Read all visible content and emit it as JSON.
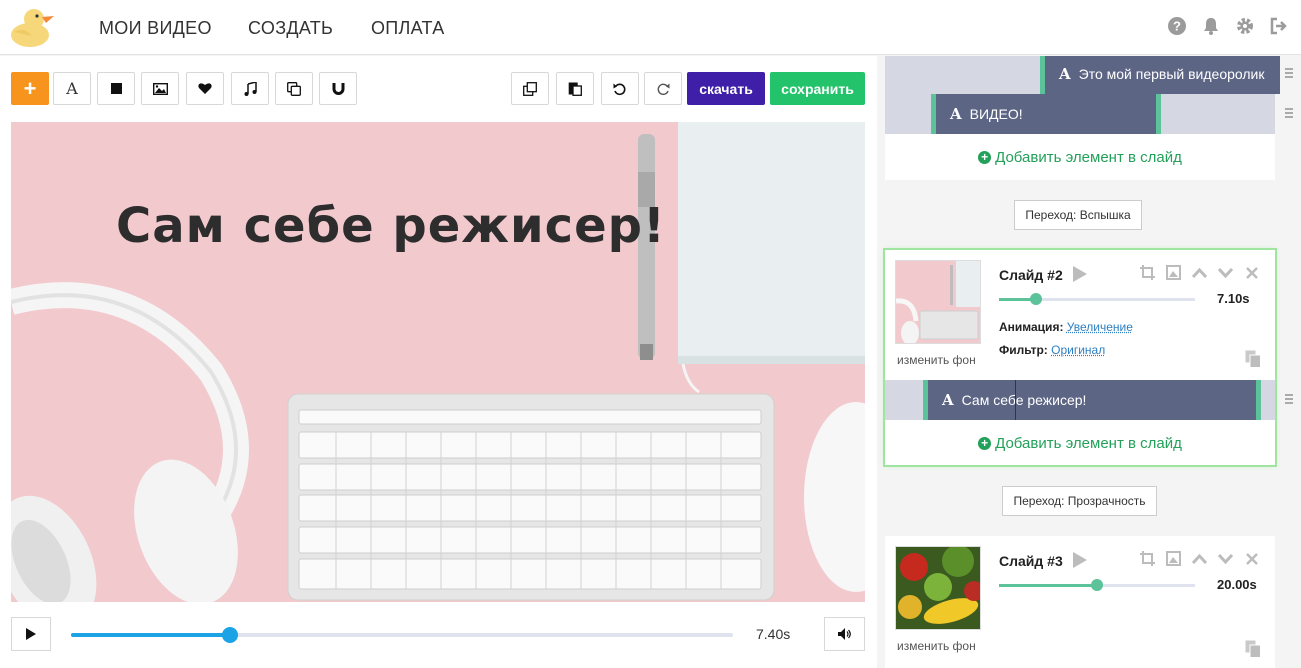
{
  "nav": {
    "items": [
      "МОИ ВИДЕО",
      "СОЗДАТЬ",
      "ОПЛАТА"
    ],
    "icons": [
      "help-icon",
      "bell-icon",
      "gear-icon",
      "logout-icon"
    ]
  },
  "toolbar": {
    "add_label": "+",
    "tools": [
      "text-icon",
      "shape-icon",
      "image-icon",
      "sticker-icon",
      "music-icon",
      "copy-icon",
      "magnet-icon"
    ],
    "actions": [
      "duplicate-icon",
      "paste-icon",
      "undo-icon",
      "redo-icon"
    ],
    "download_label": "скачать",
    "save_label": "сохранить"
  },
  "canvas": {
    "title_text": "Сам себе режисер!"
  },
  "player": {
    "time": "7.40s",
    "progress": 0.24
  },
  "slides": {
    "slide1_elements": [
      {
        "text": "Это мой первый видеоролик"
      },
      {
        "text": "ВИДЕО!"
      }
    ],
    "add_element_label": "Добавить элемент в слайд",
    "transition1": "Переход: Вспышка",
    "slide2": {
      "title": "Слайд #2",
      "duration": "7.10s",
      "progress": 0.19,
      "change_bg": "изменить фон",
      "animation_label": "Анимация:",
      "animation_value": "Увеличение",
      "filter_label": "Фильтр:",
      "filter_value": "Оригинал",
      "element_text": "Сам себе режисер!"
    },
    "transition2": "Переход: Прозрачность",
    "slide3": {
      "title": "Слайд #3",
      "duration": "20.00s",
      "progress": 0.5,
      "change_bg": "изменить фон"
    }
  },
  "colors": {
    "accent_orange": "#f7941d",
    "download_purple": "#3f1ea8",
    "save_green": "#23c36b",
    "player_blue": "#1ba3e6",
    "element_bar": "#5d6585",
    "link_green": "#23a05a"
  }
}
